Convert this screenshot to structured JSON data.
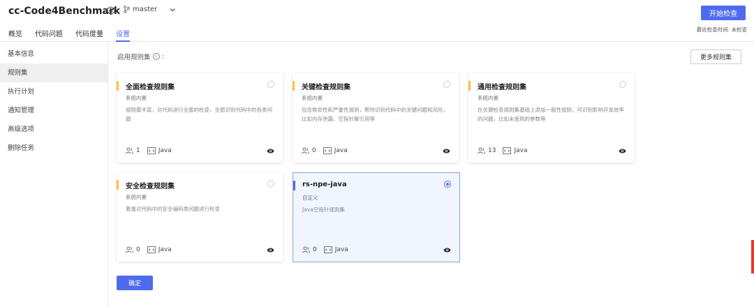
{
  "header": {
    "repo_name": "cc-Code4Benchmark",
    "branch": "master",
    "start_button": "开始检查",
    "last_check": "最近检查时间: 未检查"
  },
  "tabs": [
    {
      "label": "概览"
    },
    {
      "label": "代码问题"
    },
    {
      "label": "代码度量"
    },
    {
      "label": "设置"
    }
  ],
  "sidebar": {
    "items": [
      {
        "label": "基本信息"
      },
      {
        "label": "规则集"
      },
      {
        "label": "执行计划"
      },
      {
        "label": "通知管理"
      },
      {
        "label": "高级选项"
      },
      {
        "label": "删除任务"
      }
    ]
  },
  "main": {
    "section_label": "启用规则集",
    "more_button": "更多规则集",
    "confirm_button": "确定",
    "cards": [
      {
        "title": "全面检查规则集",
        "subtitle": "系统内置",
        "desc": "规则最丰富，对代码进行全面的检查，全面识别代码中的各类问题",
        "count": "1",
        "lang": "Java"
      },
      {
        "title": "关键检查规则集",
        "subtitle": "系统内置",
        "desc": "包含致命性和严重性规则，帮你识别代码中的关键问题和风险，比如内存泄露、空指针解引用等",
        "count": "0",
        "lang": "Java"
      },
      {
        "title": "通用检查规则集",
        "subtitle": "系统内置",
        "desc": "在关键检查规则集基础上添加一般性规则，可识别影响开发效率的问题，比如未使用的参数等",
        "count": "13",
        "lang": "Java"
      },
      {
        "title": "安全检查规则集",
        "subtitle": "系统内置",
        "desc": "着重对代码中的安全编码类问题进行检查",
        "count": "0",
        "lang": "Java"
      },
      {
        "title": "rs-npe-java",
        "subtitle": "自定义",
        "desc": "Java空指针规则集",
        "count": "0",
        "lang": "Java"
      }
    ]
  },
  "colors": {
    "accent": "#4f6bed",
    "card_bar": "#f5c242"
  }
}
